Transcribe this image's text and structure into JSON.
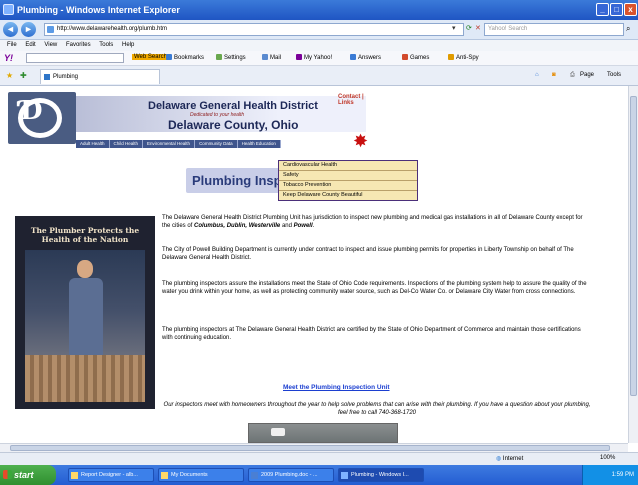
{
  "window": {
    "title": "Plumbing - Windows Internet Explorer",
    "controls": {
      "min": "_",
      "max": "□",
      "close": "x"
    }
  },
  "address_bar": {
    "back": "◄",
    "forward": "►",
    "url": "http://www.delawarehealth.org/plumb.htm",
    "search_placeholder": "Yahoo! Search"
  },
  "menu": [
    "File",
    "Edit",
    "View",
    "Favorites",
    "Tools",
    "Help"
  ],
  "yahoo_toolbar": {
    "logo": "Y!",
    "items": [
      "Web Search",
      "Bookmarks",
      "Settings",
      "Mail",
      "My Yahoo!",
      "Answers",
      "Games",
      "Anti-Spy"
    ]
  },
  "tab": {
    "label": "Plumbing"
  },
  "command_bar": [
    "Page",
    "Tools"
  ],
  "header": {
    "district": "Delaware General Health District",
    "tagline": "Dedicated to your health",
    "county": "Delaware County, Ohio",
    "contact": "Contact | Links",
    "nav": [
      "Adult Health",
      "Child Health",
      "Environmental Health",
      "Community Data",
      "Health Education"
    ]
  },
  "dropdown": [
    "Cardiovascular Health",
    "Safety",
    "Tobacco Prevention",
    "Keep Delaware County Beautiful"
  ],
  "page_title": "Plumbing Inspec",
  "poster": {
    "line1": "The Plumber Protects the",
    "line2": "Health of the Nation"
  },
  "paragraphs": {
    "p1_a": "The Delaware General Health District Plumbing Unit has jurisdiction to inspect new plumbing and medical gas installations in all of Delaware County except for the cities of",
    "p1_cities": "Columbus, Dublin, Westerville",
    "p1_and": "and",
    "p1_powell": "Powell",
    "p2": "The City of Powell Building Department is currently under contract to inspect and issue plumbing permits for properties in Liberty Township on behalf of The Delaware General Health District.",
    "p3": "The plumbing inspectors assure the installations meet the State of Ohio Code requirements. Inspections of the plumbing system help to assure the quality of the water you drink within your home, as well as protecting community water source, such as Del-Co Water Co. or Delaware City Water from cross connections.",
    "p4": "The plumbing inspectors at The Delaware General Health District are certified by the State of Ohio Department of Commerce and maintain those certifications with continuing education."
  },
  "meet_link": "Meet the Plumbing Inspection Unit",
  "note": "Our inspectors meet with homeowners throughout the year to help solve problems that can arise with their plumbing. If you have a question about your plumbing, feel free to call 740-368-1720",
  "status": {
    "zone": "Internet",
    "zoom": "100%"
  },
  "taskbar": {
    "start": "start",
    "items": [
      "Report Designer - alb...",
      "My Documents",
      "2009 Plumbing.doc - ...",
      "Plumbing - Windows I..."
    ],
    "clock": "1:59 PM"
  }
}
